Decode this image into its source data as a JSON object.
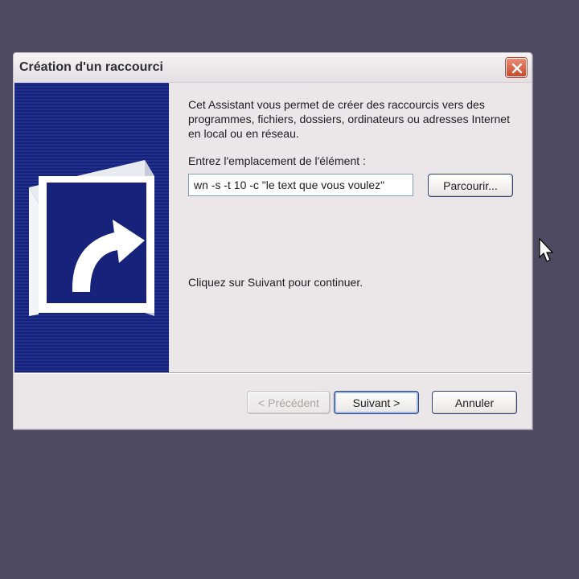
{
  "dialog": {
    "title": "Création d'un raccourci",
    "close_icon": "close-icon",
    "wizard_image_icon": "shortcut-arrow-icon",
    "intro_text": "Cet Assistant vous permet de créer des raccourcis vers des programmes, fichiers, dossiers, ordinateurs ou adresses Internet en local ou en réseau.",
    "location_label": "Entrez l'emplacement de l'élément :",
    "location_value": "wn -s -t 10 -c \"le text que vous voulez\"",
    "browse_label": "Parcourir...",
    "hint_text": "Cliquez sur Suivant pour continuer.",
    "buttons": {
      "back": "< Précédent",
      "next": "Suivant >",
      "cancel": "Annuler"
    }
  },
  "colors": {
    "desktop": "#4e4a62",
    "dialog_bg": "#ebe6e8",
    "wizard_blue": "#1d2a8a",
    "close_red": "#d0573a"
  }
}
